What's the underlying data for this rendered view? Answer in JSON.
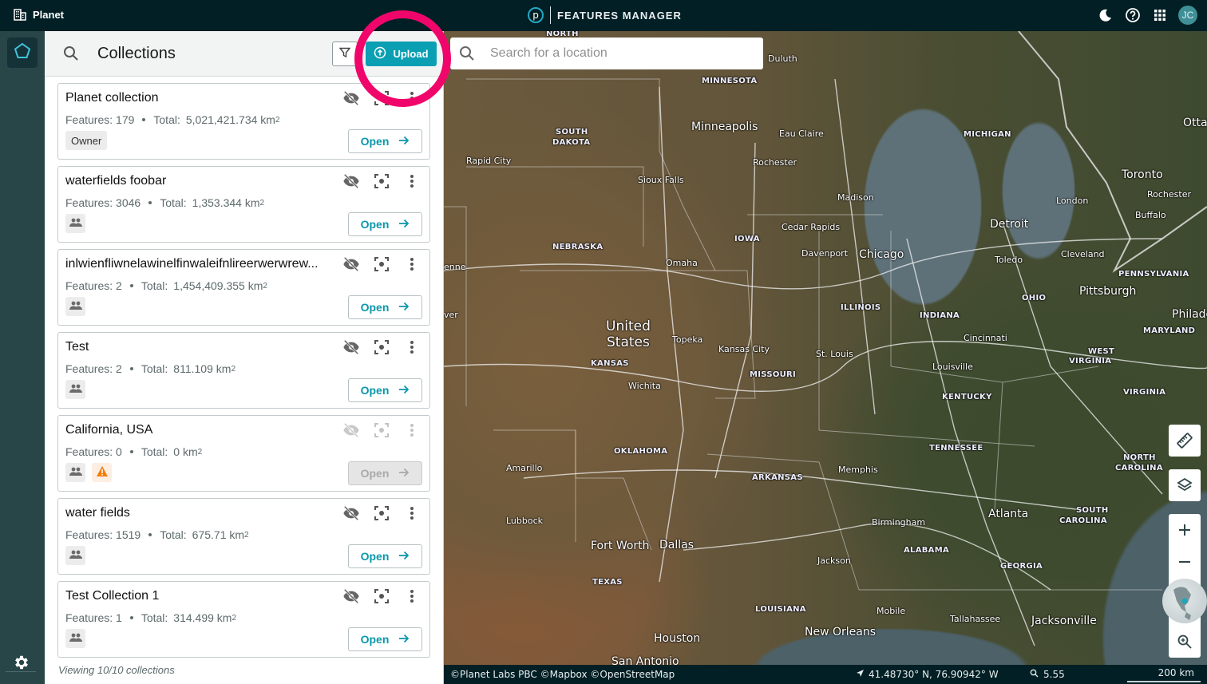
{
  "topbar": {
    "org_name": "Planet",
    "app_name": "FEATURES MANAGER",
    "app_logo_letter": "p",
    "user_initials": "JC",
    "icons": [
      "building-icon",
      "theme-moon-icon",
      "help-icon",
      "apps-grid-icon"
    ]
  },
  "rail": {
    "items": [
      {
        "name": "features-collections",
        "icon": "pentagon-icon",
        "active": true
      }
    ],
    "settings_icon": "gear-icon"
  },
  "panel": {
    "title": "Collections",
    "filter_icon": "filter-icon",
    "upload_label": "Upload",
    "features_label": "Features:",
    "total_label": "Total:",
    "area_unit": "km",
    "area_unit_exp": "2",
    "open_label": "Open",
    "footer": "Viewing 10/10 collections",
    "collections": [
      {
        "title": "Planet collection",
        "features": "179",
        "total": "5,021,421.734",
        "badges": [
          {
            "type": "text",
            "label": "Owner"
          }
        ],
        "open_enabled": true,
        "actions_enabled": true
      },
      {
        "title": "waterfields foobar",
        "features": "3046",
        "total": "1,353.344",
        "badges": [
          {
            "type": "shared"
          }
        ],
        "open_enabled": true,
        "actions_enabled": true
      },
      {
        "title": "inlwienfliwnelawinelfinwaleifnlireerwerwrew...",
        "features": "2",
        "total": "1,454,409.355",
        "badges": [
          {
            "type": "shared"
          }
        ],
        "open_enabled": true,
        "actions_enabled": true
      },
      {
        "title": "Test",
        "features": "2",
        "total": "811.109",
        "badges": [
          {
            "type": "shared"
          }
        ],
        "open_enabled": true,
        "actions_enabled": true
      },
      {
        "title": "California, USA",
        "features": "0",
        "total": "0",
        "badges": [
          {
            "type": "shared"
          },
          {
            "type": "warning"
          }
        ],
        "open_enabled": false,
        "actions_enabled": false
      },
      {
        "title": "water fields",
        "features": "1519",
        "total": "675.71",
        "badges": [
          {
            "type": "shared"
          }
        ],
        "open_enabled": true,
        "actions_enabled": true
      },
      {
        "title": "Test Collection 1",
        "features": "1",
        "total": "314.499",
        "badges": [
          {
            "type": "shared"
          }
        ],
        "open_enabled": true,
        "actions_enabled": true
      }
    ]
  },
  "map": {
    "search_placeholder": "Search for a location",
    "search_value": "",
    "labels": {
      "country": [
        "United",
        "States"
      ],
      "states": [
        "NORTH",
        "MINNESOTA",
        "SOUTH",
        "DAKOTA",
        "NEBRASKA",
        "IOWA",
        "MICHIGAN",
        "ILLINOIS",
        "INDIANA",
        "OHIO",
        "PENNSYLVANIA",
        "KANSAS",
        "MISSOURI",
        "KENTUCKY",
        "WEST",
        "VIRGINIA",
        "VIRGINIA",
        "MARYLAND",
        "OKLAHOMA",
        "ARKANSAS",
        "TENNESSEE",
        "NORTH",
        "CAROLINA",
        "SOUTH",
        "CAROLINA",
        "ALABAMA",
        "GEORGIA",
        "TEXAS",
        "LOUISIANA"
      ],
      "cities": [
        "Duluth",
        "Minneapolis",
        "Eau Claire",
        "Rochester",
        "Rapid City",
        "Sioux Falls",
        "Madison",
        "Cedar Rapids",
        "Davenport",
        "Chicago",
        "Omaha",
        "Detroit",
        "Toledo",
        "Cleveland",
        "London",
        "Toronto",
        "Rochester",
        "Buffalo",
        "Pittsburgh",
        "Otta",
        "Philade",
        "enne",
        "ver",
        "Topeka",
        "Kansas City",
        "St. Louis",
        "Cincinnati",
        "Louisville",
        "Wichita",
        "Amarillo",
        "Lubbock",
        "Fort Worth",
        "Dallas",
        "Memphis",
        "Birmingham",
        "Atlanta",
        "Jackson",
        "Mobile",
        "Tallahassee",
        "Jacksonville",
        "New Orleans",
        "Houston",
        "San Antonio"
      ]
    },
    "controls": [
      "ruler-icon",
      "layers-icon",
      "zoom-in-icon",
      "zoom-out-icon",
      "globe-minimap",
      "zoom-to-fit-icon"
    ]
  },
  "statusbar": {
    "attribution": "©Planet Labs PBC ©Mapbox ©OpenStreetMap",
    "coordinates": "41.48730° N, 76.90942° W",
    "zoom": "5.55",
    "scale": "200 km"
  },
  "annotation": {
    "highlight_color": "#f0066b",
    "target": "upload-button"
  },
  "colors": {
    "accent": "#0b9fb3",
    "topbar": "#011f24",
    "rail": "#284548",
    "warning": "#f57c00"
  }
}
